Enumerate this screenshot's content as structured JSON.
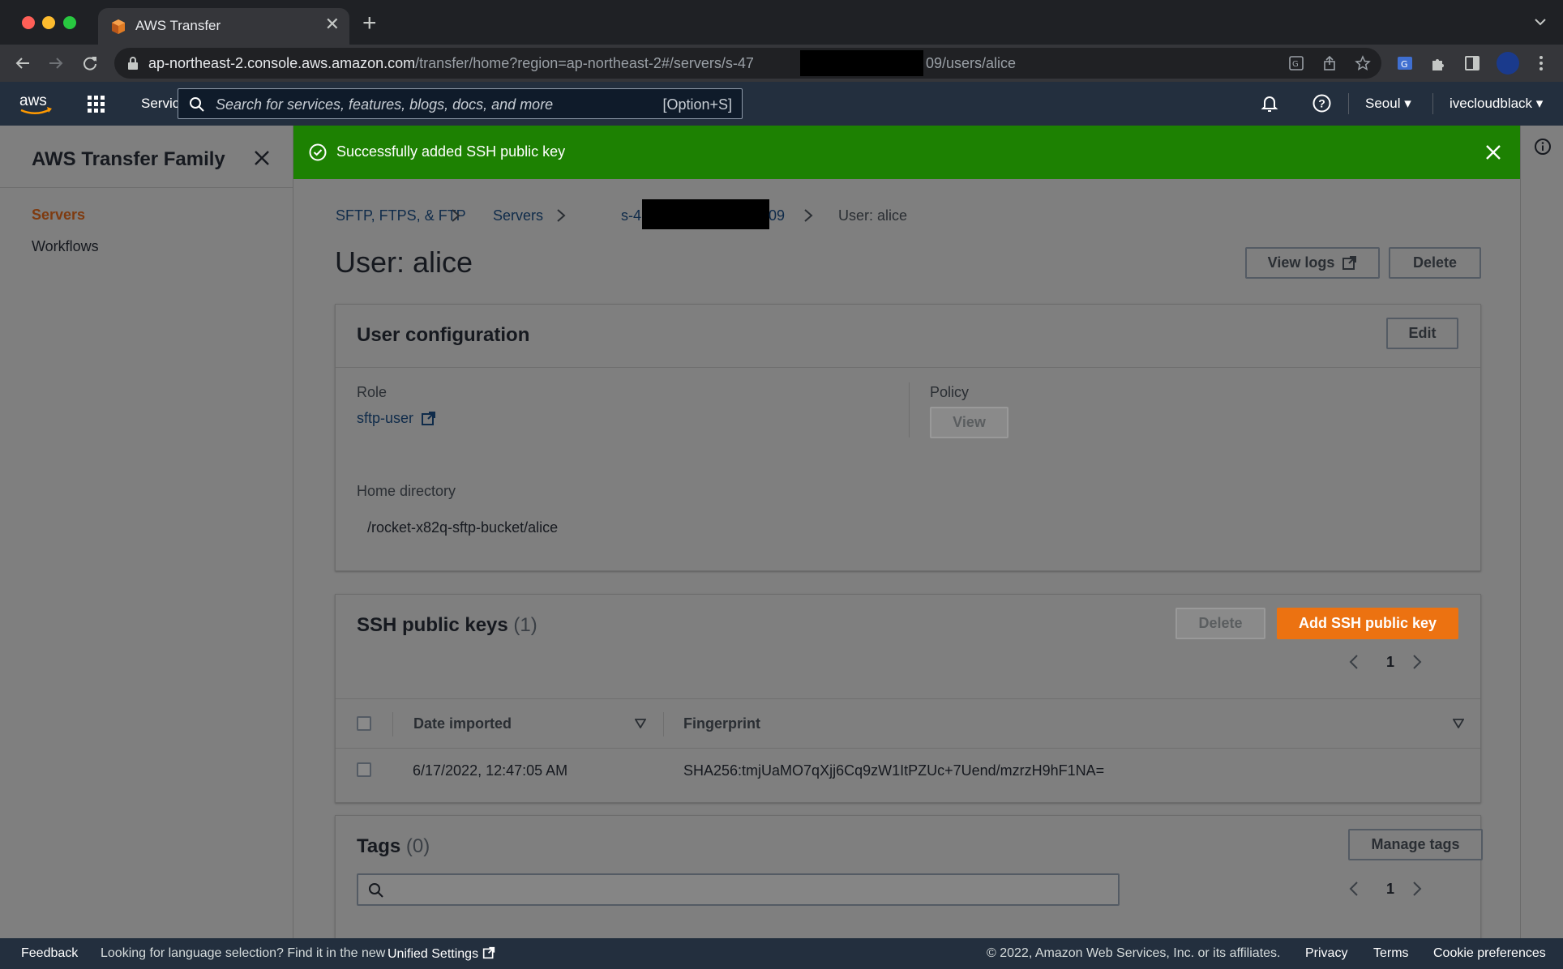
{
  "browser": {
    "tab_title": "AWS Transfer",
    "url_host": "ap-northeast-2.console.aws.amazon.com",
    "url_path": "/transfer/home?region=ap-northeast-2#/servers/s-47",
    "url_tail": "09/users/alice"
  },
  "aws_nav": {
    "logo_text": "aws",
    "services_label": "Services",
    "search_placeholder": "Search for services, features, blogs, docs, and more",
    "search_shortcut": "[Option+S]",
    "region": "Seoul",
    "account": "ivecloudblack"
  },
  "sidebar": {
    "title": "AWS Transfer Family",
    "items": [
      {
        "label": "Servers",
        "active": true
      },
      {
        "label": "Workflows",
        "active": false
      }
    ]
  },
  "flash": {
    "message": "Successfully added SSH public key",
    "color": "#1d8102"
  },
  "breadcrumb": {
    "items": [
      "SFTP, FTPS, & FTP",
      "Servers",
      "s-4",
      "09"
    ],
    "current": "User: alice"
  },
  "page": {
    "title": "User: alice",
    "view_logs_label": "View logs",
    "delete_label": "Delete"
  },
  "user_config": {
    "title": "User configuration",
    "edit_label": "Edit",
    "role_label": "Role",
    "role_value": "sftp-user",
    "policy_label": "Policy",
    "policy_view_label": "View",
    "home_dir_label": "Home directory",
    "home_dir_value": "/rocket-x82q-sftp-bucket/alice"
  },
  "ssh_keys": {
    "title": "SSH public keys",
    "count": "(1)",
    "delete_label": "Delete",
    "add_label": "Add SSH public key",
    "page": "1",
    "columns": [
      "Date imported",
      "Fingerprint"
    ],
    "rows": [
      {
        "date": "6/17/2022, 12:47:05 AM",
        "fingerprint": "SHA256:tmjUaMO7qXjj6Cq9zW1ItPZUc+7Uend/mzrzH9hF1NA="
      }
    ]
  },
  "tags": {
    "title": "Tags",
    "count": "(0)",
    "manage_label": "Manage tags",
    "search_placeholder": "",
    "page": "1"
  },
  "footer": {
    "feedback": "Feedback",
    "language_note": "Looking for language selection? Find it in the new",
    "unified_settings": "Unified Settings",
    "copyright": "© 2022, Amazon Web Services, Inc. or its affiliates.",
    "privacy": "Privacy",
    "terms": "Terms",
    "cookies": "Cookie preferences"
  },
  "colors": {
    "primary_button": "#ec7211",
    "active_nav": "#7f3b10",
    "aws_nav_bg": "#232f3e"
  }
}
